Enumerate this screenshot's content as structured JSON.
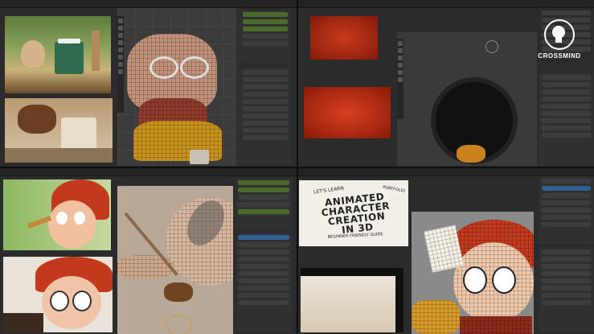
{
  "brand": {
    "logo_text": "CROSSMIND"
  },
  "book_cover": {
    "kicker": "LET'S LEARN",
    "title": "ANIMATED CHARACTER CREATION IN 3D",
    "subtitle": "BEGINNER FRIENDLY GUIDE",
    "tag": "PORTFOLIO"
  },
  "colors": {
    "app_bg": "#1b1b1b",
    "panel": "#303030",
    "accent_green": "#4a6a2a",
    "accent_blue": "#2d5f94",
    "red_frame": "#b82a12"
  }
}
